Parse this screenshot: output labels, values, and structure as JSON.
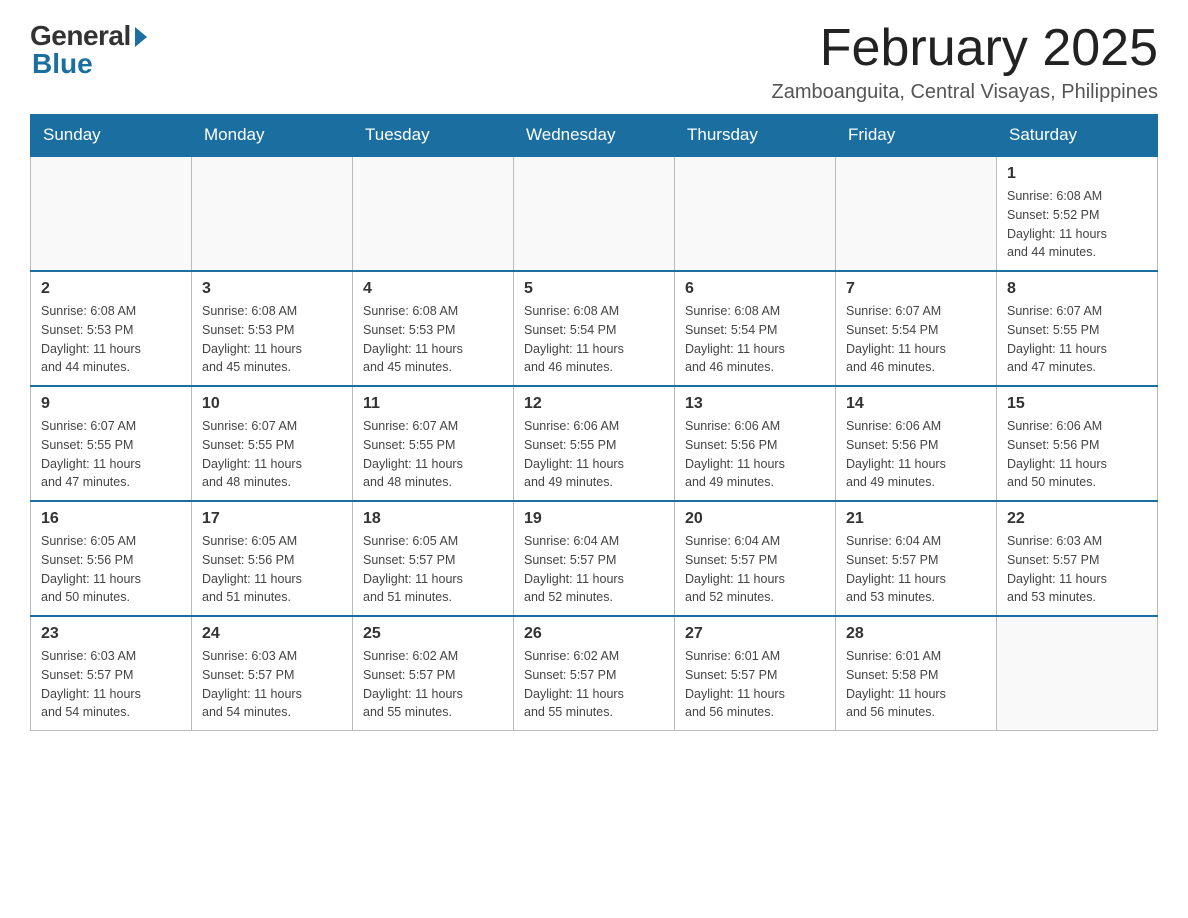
{
  "logo": {
    "general": "General",
    "blue": "Blue"
  },
  "title": "February 2025",
  "location": "Zamboanguita, Central Visayas, Philippines",
  "days_header": [
    "Sunday",
    "Monday",
    "Tuesday",
    "Wednesday",
    "Thursday",
    "Friday",
    "Saturday"
  ],
  "weeks": [
    [
      {
        "day": "",
        "info": ""
      },
      {
        "day": "",
        "info": ""
      },
      {
        "day": "",
        "info": ""
      },
      {
        "day": "",
        "info": ""
      },
      {
        "day": "",
        "info": ""
      },
      {
        "day": "",
        "info": ""
      },
      {
        "day": "1",
        "info": "Sunrise: 6:08 AM\nSunset: 5:52 PM\nDaylight: 11 hours\nand 44 minutes."
      }
    ],
    [
      {
        "day": "2",
        "info": "Sunrise: 6:08 AM\nSunset: 5:53 PM\nDaylight: 11 hours\nand 44 minutes."
      },
      {
        "day": "3",
        "info": "Sunrise: 6:08 AM\nSunset: 5:53 PM\nDaylight: 11 hours\nand 45 minutes."
      },
      {
        "day": "4",
        "info": "Sunrise: 6:08 AM\nSunset: 5:53 PM\nDaylight: 11 hours\nand 45 minutes."
      },
      {
        "day": "5",
        "info": "Sunrise: 6:08 AM\nSunset: 5:54 PM\nDaylight: 11 hours\nand 46 minutes."
      },
      {
        "day": "6",
        "info": "Sunrise: 6:08 AM\nSunset: 5:54 PM\nDaylight: 11 hours\nand 46 minutes."
      },
      {
        "day": "7",
        "info": "Sunrise: 6:07 AM\nSunset: 5:54 PM\nDaylight: 11 hours\nand 46 minutes."
      },
      {
        "day": "8",
        "info": "Sunrise: 6:07 AM\nSunset: 5:55 PM\nDaylight: 11 hours\nand 47 minutes."
      }
    ],
    [
      {
        "day": "9",
        "info": "Sunrise: 6:07 AM\nSunset: 5:55 PM\nDaylight: 11 hours\nand 47 minutes."
      },
      {
        "day": "10",
        "info": "Sunrise: 6:07 AM\nSunset: 5:55 PM\nDaylight: 11 hours\nand 48 minutes."
      },
      {
        "day": "11",
        "info": "Sunrise: 6:07 AM\nSunset: 5:55 PM\nDaylight: 11 hours\nand 48 minutes."
      },
      {
        "day": "12",
        "info": "Sunrise: 6:06 AM\nSunset: 5:55 PM\nDaylight: 11 hours\nand 49 minutes."
      },
      {
        "day": "13",
        "info": "Sunrise: 6:06 AM\nSunset: 5:56 PM\nDaylight: 11 hours\nand 49 minutes."
      },
      {
        "day": "14",
        "info": "Sunrise: 6:06 AM\nSunset: 5:56 PM\nDaylight: 11 hours\nand 49 minutes."
      },
      {
        "day": "15",
        "info": "Sunrise: 6:06 AM\nSunset: 5:56 PM\nDaylight: 11 hours\nand 50 minutes."
      }
    ],
    [
      {
        "day": "16",
        "info": "Sunrise: 6:05 AM\nSunset: 5:56 PM\nDaylight: 11 hours\nand 50 minutes."
      },
      {
        "day": "17",
        "info": "Sunrise: 6:05 AM\nSunset: 5:56 PM\nDaylight: 11 hours\nand 51 minutes."
      },
      {
        "day": "18",
        "info": "Sunrise: 6:05 AM\nSunset: 5:57 PM\nDaylight: 11 hours\nand 51 minutes."
      },
      {
        "day": "19",
        "info": "Sunrise: 6:04 AM\nSunset: 5:57 PM\nDaylight: 11 hours\nand 52 minutes."
      },
      {
        "day": "20",
        "info": "Sunrise: 6:04 AM\nSunset: 5:57 PM\nDaylight: 11 hours\nand 52 minutes."
      },
      {
        "day": "21",
        "info": "Sunrise: 6:04 AM\nSunset: 5:57 PM\nDaylight: 11 hours\nand 53 minutes."
      },
      {
        "day": "22",
        "info": "Sunrise: 6:03 AM\nSunset: 5:57 PM\nDaylight: 11 hours\nand 53 minutes."
      }
    ],
    [
      {
        "day": "23",
        "info": "Sunrise: 6:03 AM\nSunset: 5:57 PM\nDaylight: 11 hours\nand 54 minutes."
      },
      {
        "day": "24",
        "info": "Sunrise: 6:03 AM\nSunset: 5:57 PM\nDaylight: 11 hours\nand 54 minutes."
      },
      {
        "day": "25",
        "info": "Sunrise: 6:02 AM\nSunset: 5:57 PM\nDaylight: 11 hours\nand 55 minutes."
      },
      {
        "day": "26",
        "info": "Sunrise: 6:02 AM\nSunset: 5:57 PM\nDaylight: 11 hours\nand 55 minutes."
      },
      {
        "day": "27",
        "info": "Sunrise: 6:01 AM\nSunset: 5:57 PM\nDaylight: 11 hours\nand 56 minutes."
      },
      {
        "day": "28",
        "info": "Sunrise: 6:01 AM\nSunset: 5:58 PM\nDaylight: 11 hours\nand 56 minutes."
      },
      {
        "day": "",
        "info": ""
      }
    ]
  ]
}
